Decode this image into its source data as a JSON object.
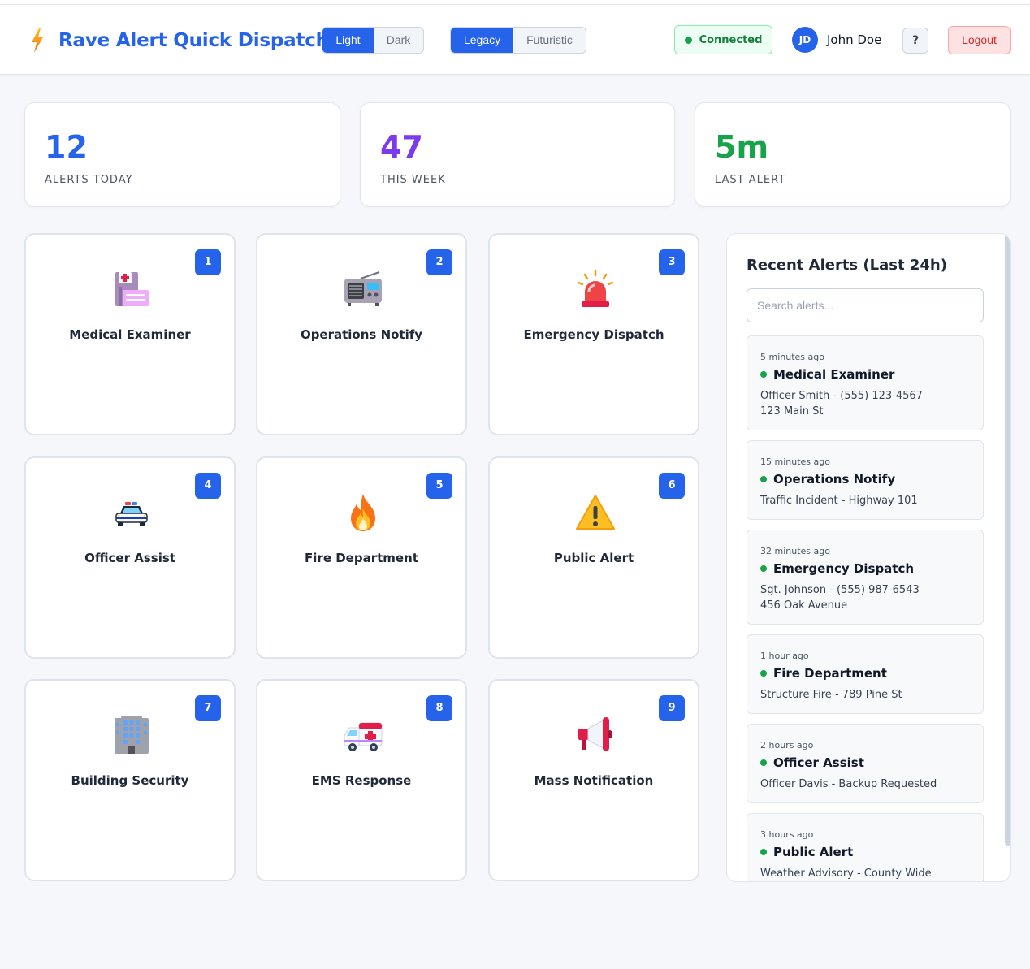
{
  "header": {
    "title": "Rave Alert Quick Dispatch",
    "brand_icon": "lightning-bolt-icon",
    "theme_toggle": {
      "options": [
        "Light",
        "Dark"
      ],
      "selected": "Light"
    },
    "style_toggle": {
      "options": [
        "Legacy",
        "Futuristic"
      ],
      "selected": "Legacy"
    },
    "connection_status": "Connected",
    "user": {
      "initials": "JD",
      "name": "John Doe"
    },
    "help_label": "?",
    "logout_label": "Logout"
  },
  "stats": [
    {
      "value": "12",
      "label": "ALERTS TODAY",
      "color": "#2563eb"
    },
    {
      "value": "47",
      "label": "THIS WEEK",
      "color": "#7c3aed"
    },
    {
      "value": "5m",
      "label": "LAST ALERT",
      "color": "#16a34a"
    }
  ],
  "tiles": [
    {
      "number": "1",
      "label": "Medical Examiner",
      "icon": "hospital-icon"
    },
    {
      "number": "2",
      "label": "Operations Notify",
      "icon": "radio-icon"
    },
    {
      "number": "3",
      "label": "Emergency Dispatch",
      "icon": "siren-light-icon"
    },
    {
      "number": "4",
      "label": "Officer Assist",
      "icon": "police-car-icon"
    },
    {
      "number": "5",
      "label": "Fire Department",
      "icon": "fire-icon"
    },
    {
      "number": "6",
      "label": "Public Alert",
      "icon": "warning-icon"
    },
    {
      "number": "7",
      "label": "Building Security",
      "icon": "office-building-icon"
    },
    {
      "number": "8",
      "label": "EMS Response",
      "icon": "ambulance-icon"
    },
    {
      "number": "9",
      "label": "Mass Notification",
      "icon": "megaphone-icon"
    }
  ],
  "recent": {
    "title": "Recent Alerts (Last 24h)",
    "search_placeholder": "Search alerts...",
    "alerts": [
      {
        "time": "5 minutes ago",
        "type": "Medical Examiner",
        "line1": "Officer Smith - (555) 123-4567",
        "line2": "123 Main St"
      },
      {
        "time": "15 minutes ago",
        "type": "Operations Notify",
        "line1": "Traffic Incident - Highway 101",
        "line2": ""
      },
      {
        "time": "32 minutes ago",
        "type": "Emergency Dispatch",
        "line1": "Sgt. Johnson - (555) 987-6543",
        "line2": "456 Oak Avenue"
      },
      {
        "time": "1 hour ago",
        "type": "Fire Department",
        "line1": "Structure Fire - 789 Pine St",
        "line2": ""
      },
      {
        "time": "2 hours ago",
        "type": "Officer Assist",
        "line1": "Officer Davis - Backup Requested",
        "line2": ""
      },
      {
        "time": "3 hours ago",
        "type": "Public Alert",
        "line1": "Weather Advisory - County Wide",
        "line2": ""
      }
    ]
  }
}
